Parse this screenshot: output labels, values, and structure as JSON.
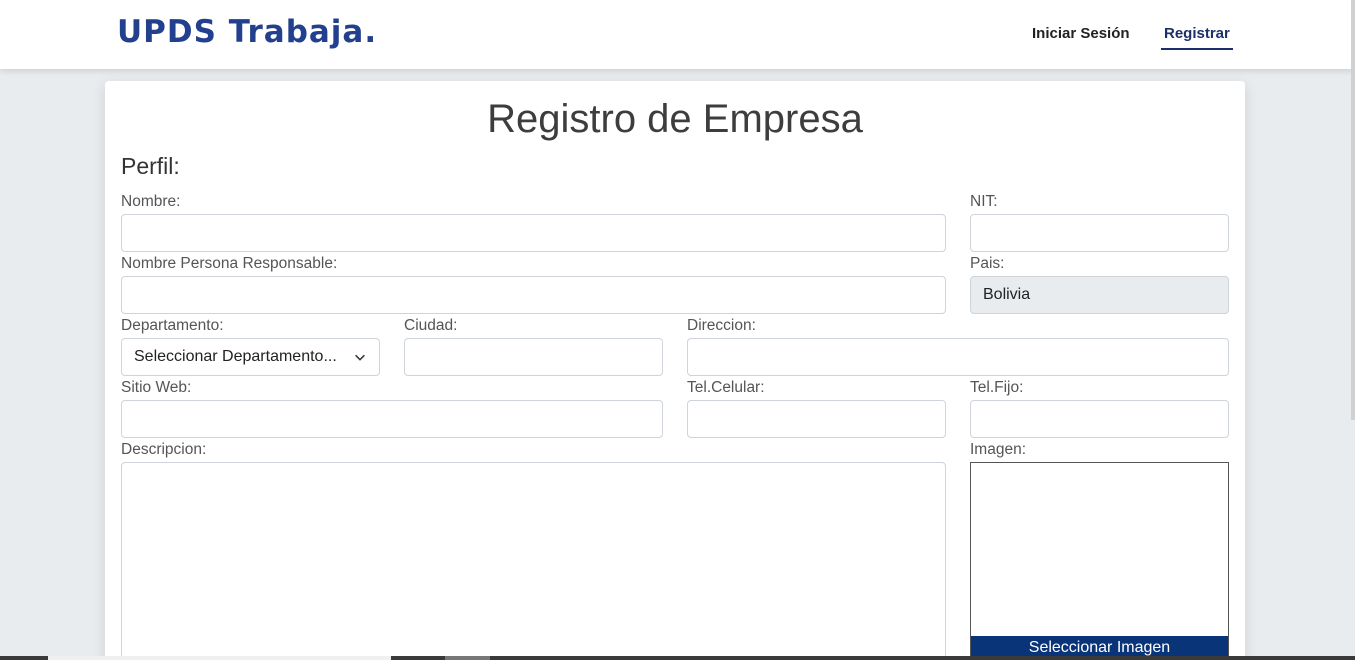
{
  "nav": {
    "brand": "UPDS Trabaja.",
    "login": "Iniciar Sesión",
    "register": "Registrar"
  },
  "form": {
    "title": "Registro de Empresa",
    "section": "Perfil:",
    "nombre_label": "Nombre:",
    "nit_label": "NIT:",
    "responsable_label": "Nombre Persona Responsable:",
    "pais_label": "Pais:",
    "pais_value": "Bolivia",
    "departamento_label": "Departamento:",
    "departamento_value": "Seleccionar Departamento...",
    "ciudad_label": "Ciudad:",
    "direccion_label": "Direccion:",
    "sitio_label": "Sitio Web:",
    "celular_label": "Tel.Celular:",
    "fijo_label": "Tel.Fijo:",
    "descripcion_label": "Descripcion:",
    "imagen_label": "Imagen:",
    "imagen_button": "Seleccionar Imagen"
  },
  "colors": {
    "brand": "#23408e",
    "button": "#0a3478"
  }
}
